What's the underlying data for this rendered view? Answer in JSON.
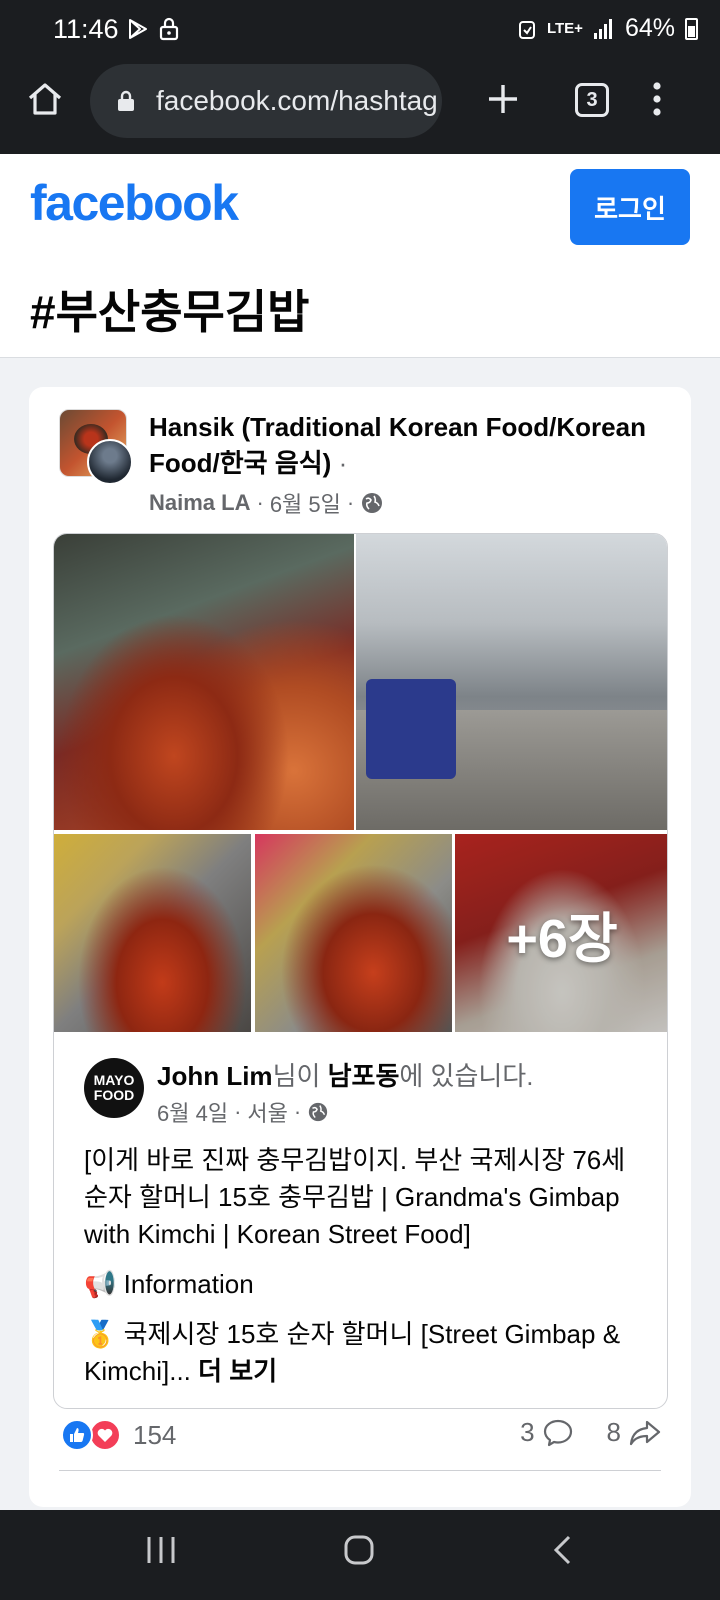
{
  "status_bar": {
    "time": "11:46",
    "network": "LTE+",
    "battery": "64%"
  },
  "browser": {
    "url": "facebook.com/hashtag",
    "tab_count": "3"
  },
  "fb_header": {
    "logo": "facebook",
    "login_label": "로그인",
    "hashtag_title": "#부산충무김밥"
  },
  "post": {
    "title": "Hansik (Traditional Korean Food/Korean Food/한국 음식)",
    "title_suffix": "·",
    "author": "Naima LA",
    "meta_sep1": "·",
    "date": "6월 5일",
    "meta_sep2": "·",
    "more_photos": "+6장",
    "shared": {
      "avatar_text": "MAYO FOOD",
      "user": "John Lim",
      "was_in_1": "님이 ",
      "place": "남포동",
      "was_in_2": "에 있습니다.",
      "date": "6월 4일",
      "sep1": "·",
      "location": "서울",
      "sep2": "·",
      "body1": "[이게 바로 진짜 충무김밥이지. 부산 국제시장 76세 순자 할머니 15호 충무김밥 | Grandma's Gimbap with Kimchi | Korean Street Food]",
      "info_emoji": "📢",
      "info_label": "Information",
      "medal_emoji": "🥇",
      "body3": "국제시장 15호 순자 할머니 [Street Gimbap & Kimchi]...",
      "see_more": "더 보기"
    },
    "reactions_count": "154",
    "comments_count": "3",
    "shares_count": "8"
  },
  "colors": {
    "brand": "#1877f2",
    "love": "#f33e58",
    "chrome_bg": "#1b1d20"
  }
}
